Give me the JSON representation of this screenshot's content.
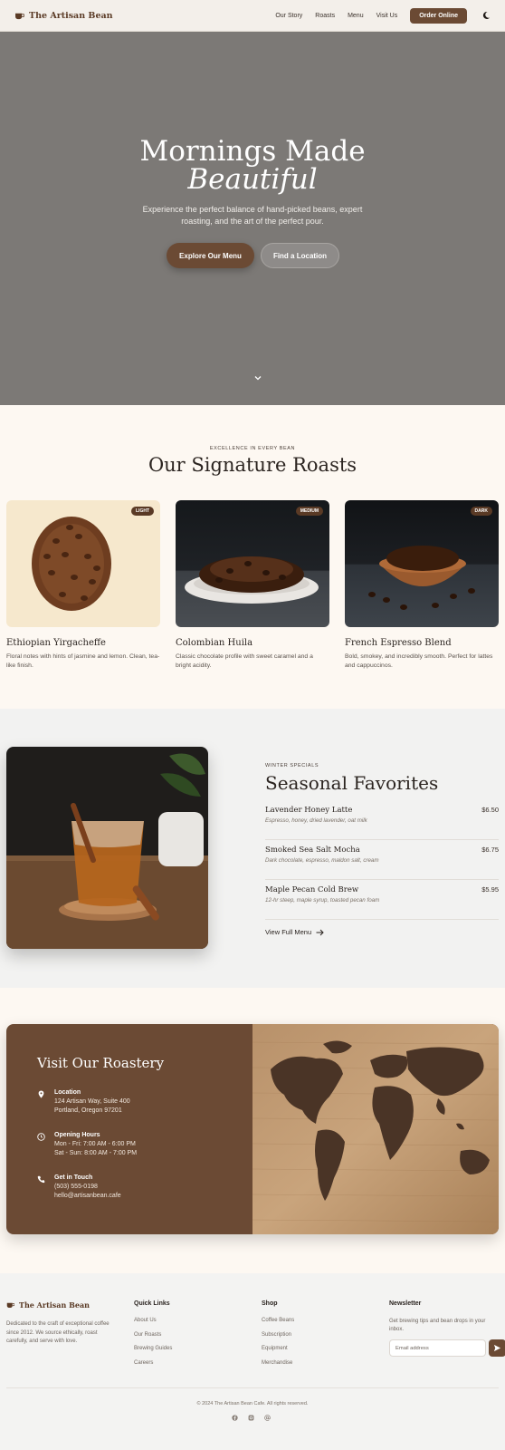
{
  "nav": {
    "brand": "The Artisan Bean",
    "links": [
      "Our Story",
      "Roasts",
      "Menu",
      "Visit Us"
    ],
    "order_button": "Order Online",
    "theme_icon": "moon-icon"
  },
  "hero": {
    "title_line1": "Mornings Made",
    "title_line2": "Beautiful",
    "subtitle": "Experience the perfect balance of hand-picked beans, expert roasting, and the art of the perfect pour.",
    "primary_button": "Explore Our Menu",
    "secondary_button": "Find a Location",
    "scroll_icon": "chevron-down-icon",
    "background_color": "#7c7976"
  },
  "roasts": {
    "eyebrow": "Excellence in every bean",
    "title": "Our Signature Roasts",
    "cards": [
      {
        "badge": "Light",
        "name": "Ethiopian Yirgacheffe",
        "description": "Floral notes with hints of jasmine and lemon. Clean, tea-like finish."
      },
      {
        "badge": "Medium",
        "name": "Colombian Huila",
        "description": "Classic chocolate profile with sweet caramel and a bright acidity."
      },
      {
        "badge": "Dark",
        "name": "French Espresso Blend",
        "description": "Bold, smokey, and incredibly smooth. Perfect for lattes and cappuccinos."
      }
    ]
  },
  "seasonal": {
    "eyebrow": "Winter Specials",
    "title": "Seasonal Favorites",
    "items": [
      {
        "name": "Lavender Honey Latte",
        "description": "Espresso, honey, dried lavender, oat milk",
        "price": "$6.50"
      },
      {
        "name": "Smoked Sea Salt Mocha",
        "description": "Dark chocolate, espresso, maldon salt, cream",
        "price": "$6.75"
      },
      {
        "name": "Maple Pecan Cold Brew",
        "description": "12-hr steep, maple syrup, toasted pecan foam",
        "price": "$5.95"
      }
    ],
    "view_menu": "View Full Menu"
  },
  "roastery": {
    "title": "Visit Our Roastery",
    "location": {
      "label": "Location",
      "line1": "124 Artisan Way, Suite 400",
      "line2": "Portland, Oregon 97201"
    },
    "hours": {
      "label": "Opening Hours",
      "line1": "Mon - Fri: 7:00 AM - 6:00 PM",
      "line2": "Sat - Sun: 8:00 AM - 7:00 PM"
    },
    "contact": {
      "label": "Get in Touch",
      "line1": "(503) 555-0198",
      "line2": "hello@artisanbean.cafe"
    }
  },
  "footer": {
    "brand": "The Artisan Bean",
    "about": "Dedicated to the craft of exceptional coffee since 2012. We source ethically, roast carefully, and serve with love.",
    "quick_links": {
      "title": "Quick Links",
      "items": [
        "About Us",
        "Our Roasts",
        "Brewing Guides",
        "Careers"
      ]
    },
    "shop": {
      "title": "Shop",
      "items": [
        "Coffee Beans",
        "Subscription",
        "Equipment",
        "Merchandise"
      ]
    },
    "newsletter": {
      "title": "Newsletter",
      "text": "Get brewing tips and bean drops in your inbox.",
      "placeholder": "Email address"
    },
    "copyright": "© 2024 The Artisan Bean Cafe. All rights reserved.",
    "social_icons": [
      "facebook-icon",
      "instagram-icon",
      "at-sign-icon"
    ]
  },
  "colors": {
    "brand_brown": "#6b4a34",
    "cream": "#fdf8f2"
  }
}
